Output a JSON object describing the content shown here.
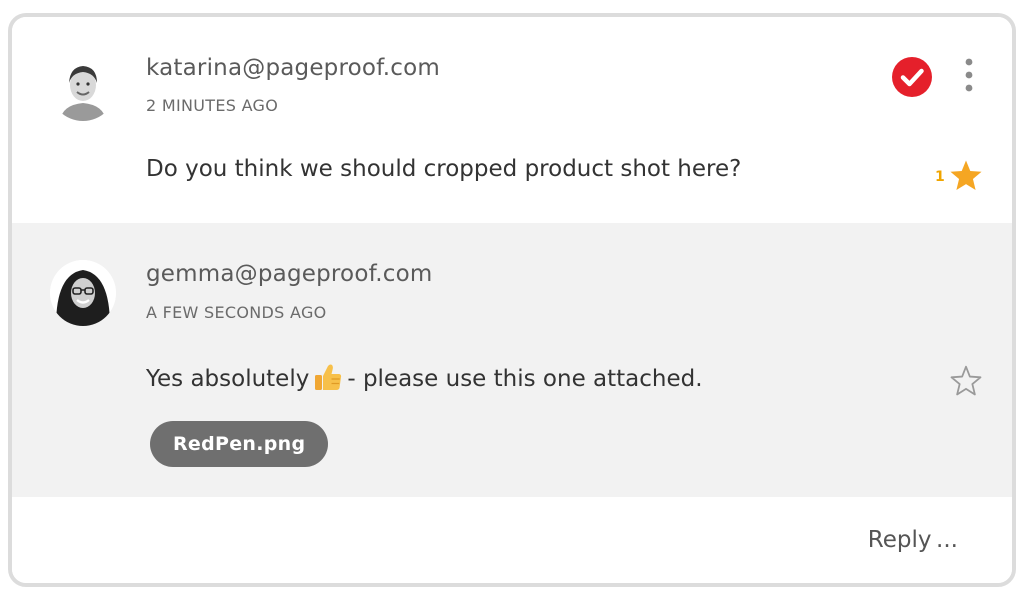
{
  "comments": [
    {
      "author": "katarina@pageproof.com",
      "time": "2 MINUTES AGO",
      "text": "Do you think we should cropped product shot here?",
      "star_count": "1",
      "starred": true,
      "resolved": true
    },
    {
      "author": "gemma@pageproof.com",
      "time": "A FEW SECONDS AGO",
      "text_before": "Yes absolutely",
      "text_after": "- please use this one attached.",
      "attachment": "RedPen.png",
      "starred": false
    }
  ],
  "footer": {
    "reply_label": "Reply ..."
  },
  "colors": {
    "resolved": "#e5202b",
    "star": "#f5a623",
    "attachment_bg": "#6f6f6f",
    "reply_area_bg": "#f2f2f2"
  },
  "icons": {
    "resolved": "check-circle-icon",
    "more": "vertical-ellipsis-icon",
    "star_filled": "star-filled-icon",
    "star_empty": "star-outline-icon",
    "emoji": "thumbs-up-emoji"
  }
}
